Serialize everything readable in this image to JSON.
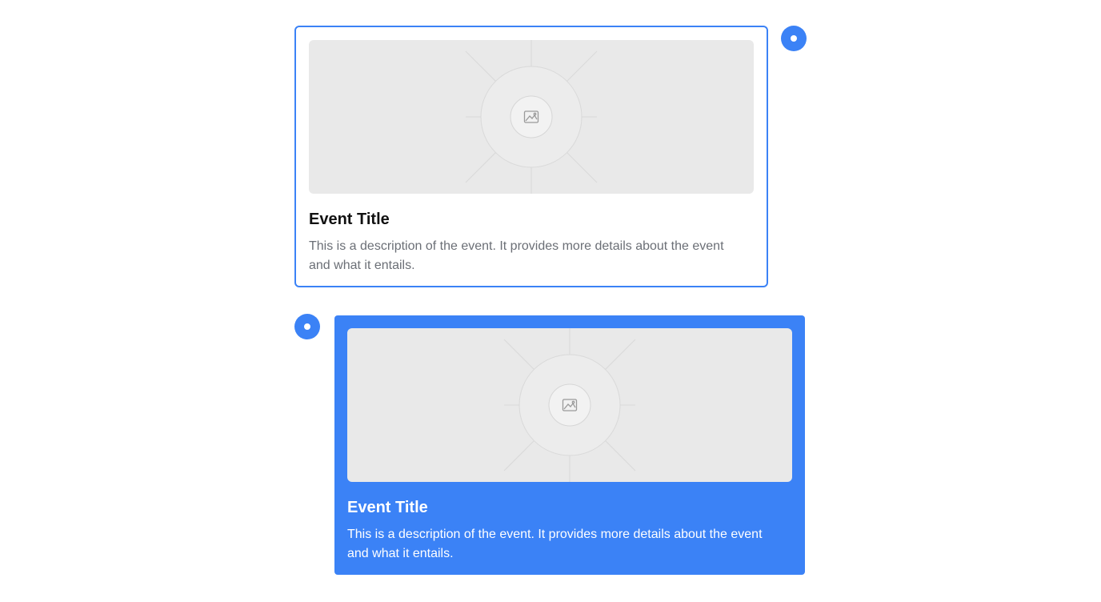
{
  "colors": {
    "accent": "#3b82f6",
    "placeholder_bg": "#e9e9e9",
    "title_dark": "#111111",
    "description_gray": "#6b6f76"
  },
  "timeline": {
    "events": [
      {
        "title": "Event Title",
        "description": "This is a description of the event. It provides more details about the event and what it entails.",
        "image_icon": "image-placeholder-icon",
        "marker_icon": "timeline-dot-icon",
        "state": "outlined"
      },
      {
        "title": "Event Title",
        "description": "This is a description of the event. It provides more details about the event and what it entails.",
        "image_icon": "image-placeholder-icon",
        "marker_icon": "timeline-dot-icon",
        "state": "filled"
      }
    ]
  }
}
